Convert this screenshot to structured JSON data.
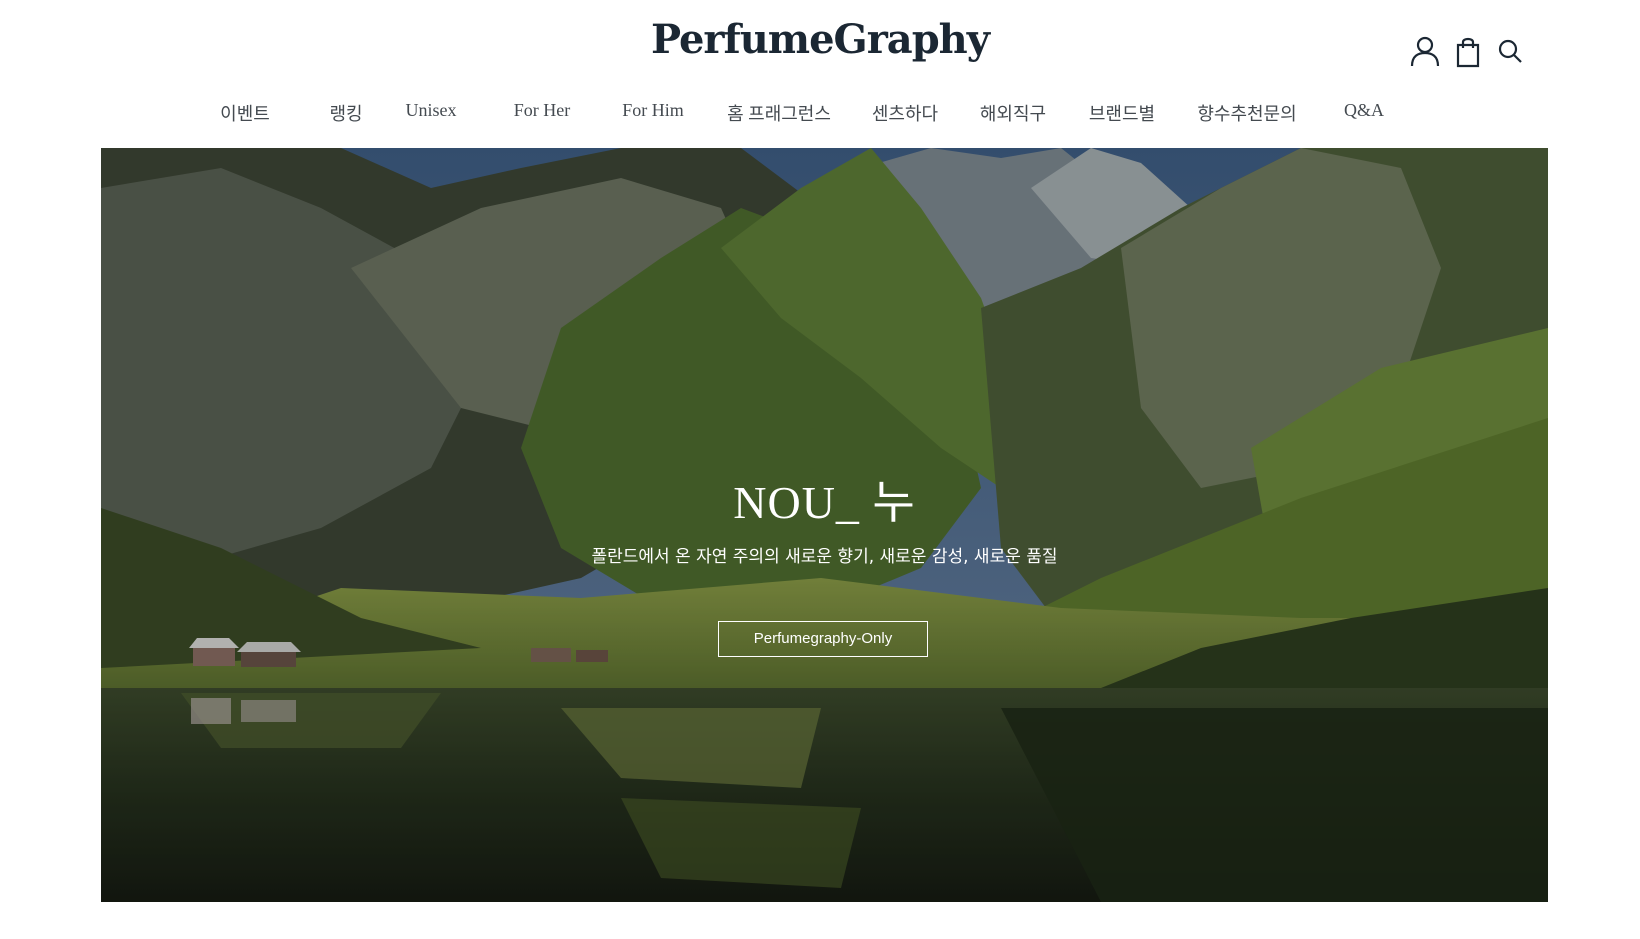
{
  "header": {
    "logo": "PerfumeGraphy",
    "icons": [
      "user-icon",
      "cart-icon",
      "search-icon"
    ]
  },
  "nav": {
    "items": [
      {
        "label": "이벤트"
      },
      {
        "label": "랭킹"
      },
      {
        "label": "Unisex"
      },
      {
        "label": "For Her"
      },
      {
        "label": "For Him"
      },
      {
        "label": "홈 프래그런스"
      },
      {
        "label": "센츠하다"
      },
      {
        "label": "해외직구"
      },
      {
        "label": "브랜드별"
      },
      {
        "label": "향수추천문의"
      },
      {
        "label": "Q&A"
      }
    ]
  },
  "hero": {
    "title": "NOU_ 누",
    "subtitle": "폴란드에서 온 자연 주의의 새로운 향기, 새로운 감성, 새로운 품질",
    "button": "Perfumegraphy-Only"
  },
  "colors": {
    "text": "#1b2733",
    "nav_text": "#444a50",
    "hero_text": "#ffffff"
  }
}
